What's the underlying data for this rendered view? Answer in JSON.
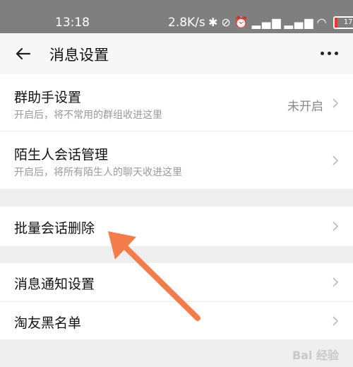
{
  "status": {
    "time": "13:18",
    "net_speed": "2.8K/s",
    "icons": [
      "bluetooth-icon",
      "mute-icon",
      "alarm-icon",
      "signal-icon",
      "signal-icon",
      "wifi-icon"
    ],
    "battery": "17"
  },
  "header": {
    "title": "消息设置"
  },
  "items": [
    {
      "label": "群助手设置",
      "sub": "开启后，将不常用的群组收进这里",
      "value": "未开启"
    },
    {
      "label": "陌生人会话管理",
      "sub": "开启后，将所有陌生人的聊天收进这里"
    },
    {
      "label": "批量会话删除"
    },
    {
      "label": "消息通知设置"
    },
    {
      "label": "淘友黑名单"
    }
  ],
  "watermark": "Bai 经验",
  "colors": {
    "arrow": "#f47c4a",
    "statusbar": "#7f7f7f"
  }
}
